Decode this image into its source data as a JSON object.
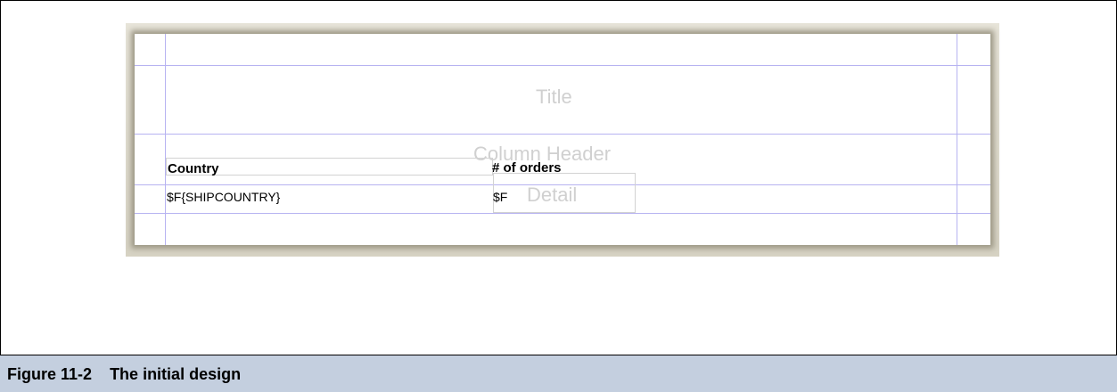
{
  "designer": {
    "bands": {
      "title": "Title",
      "column_header": "Column Header",
      "detail": "Detail"
    },
    "column_headers": [
      "Country",
      "# of orders"
    ],
    "detail_fields": [
      "$F{SHIPCOUNTRY}",
      "$F"
    ]
  },
  "caption": {
    "label": "Figure 11-2",
    "text": "The initial design"
  }
}
